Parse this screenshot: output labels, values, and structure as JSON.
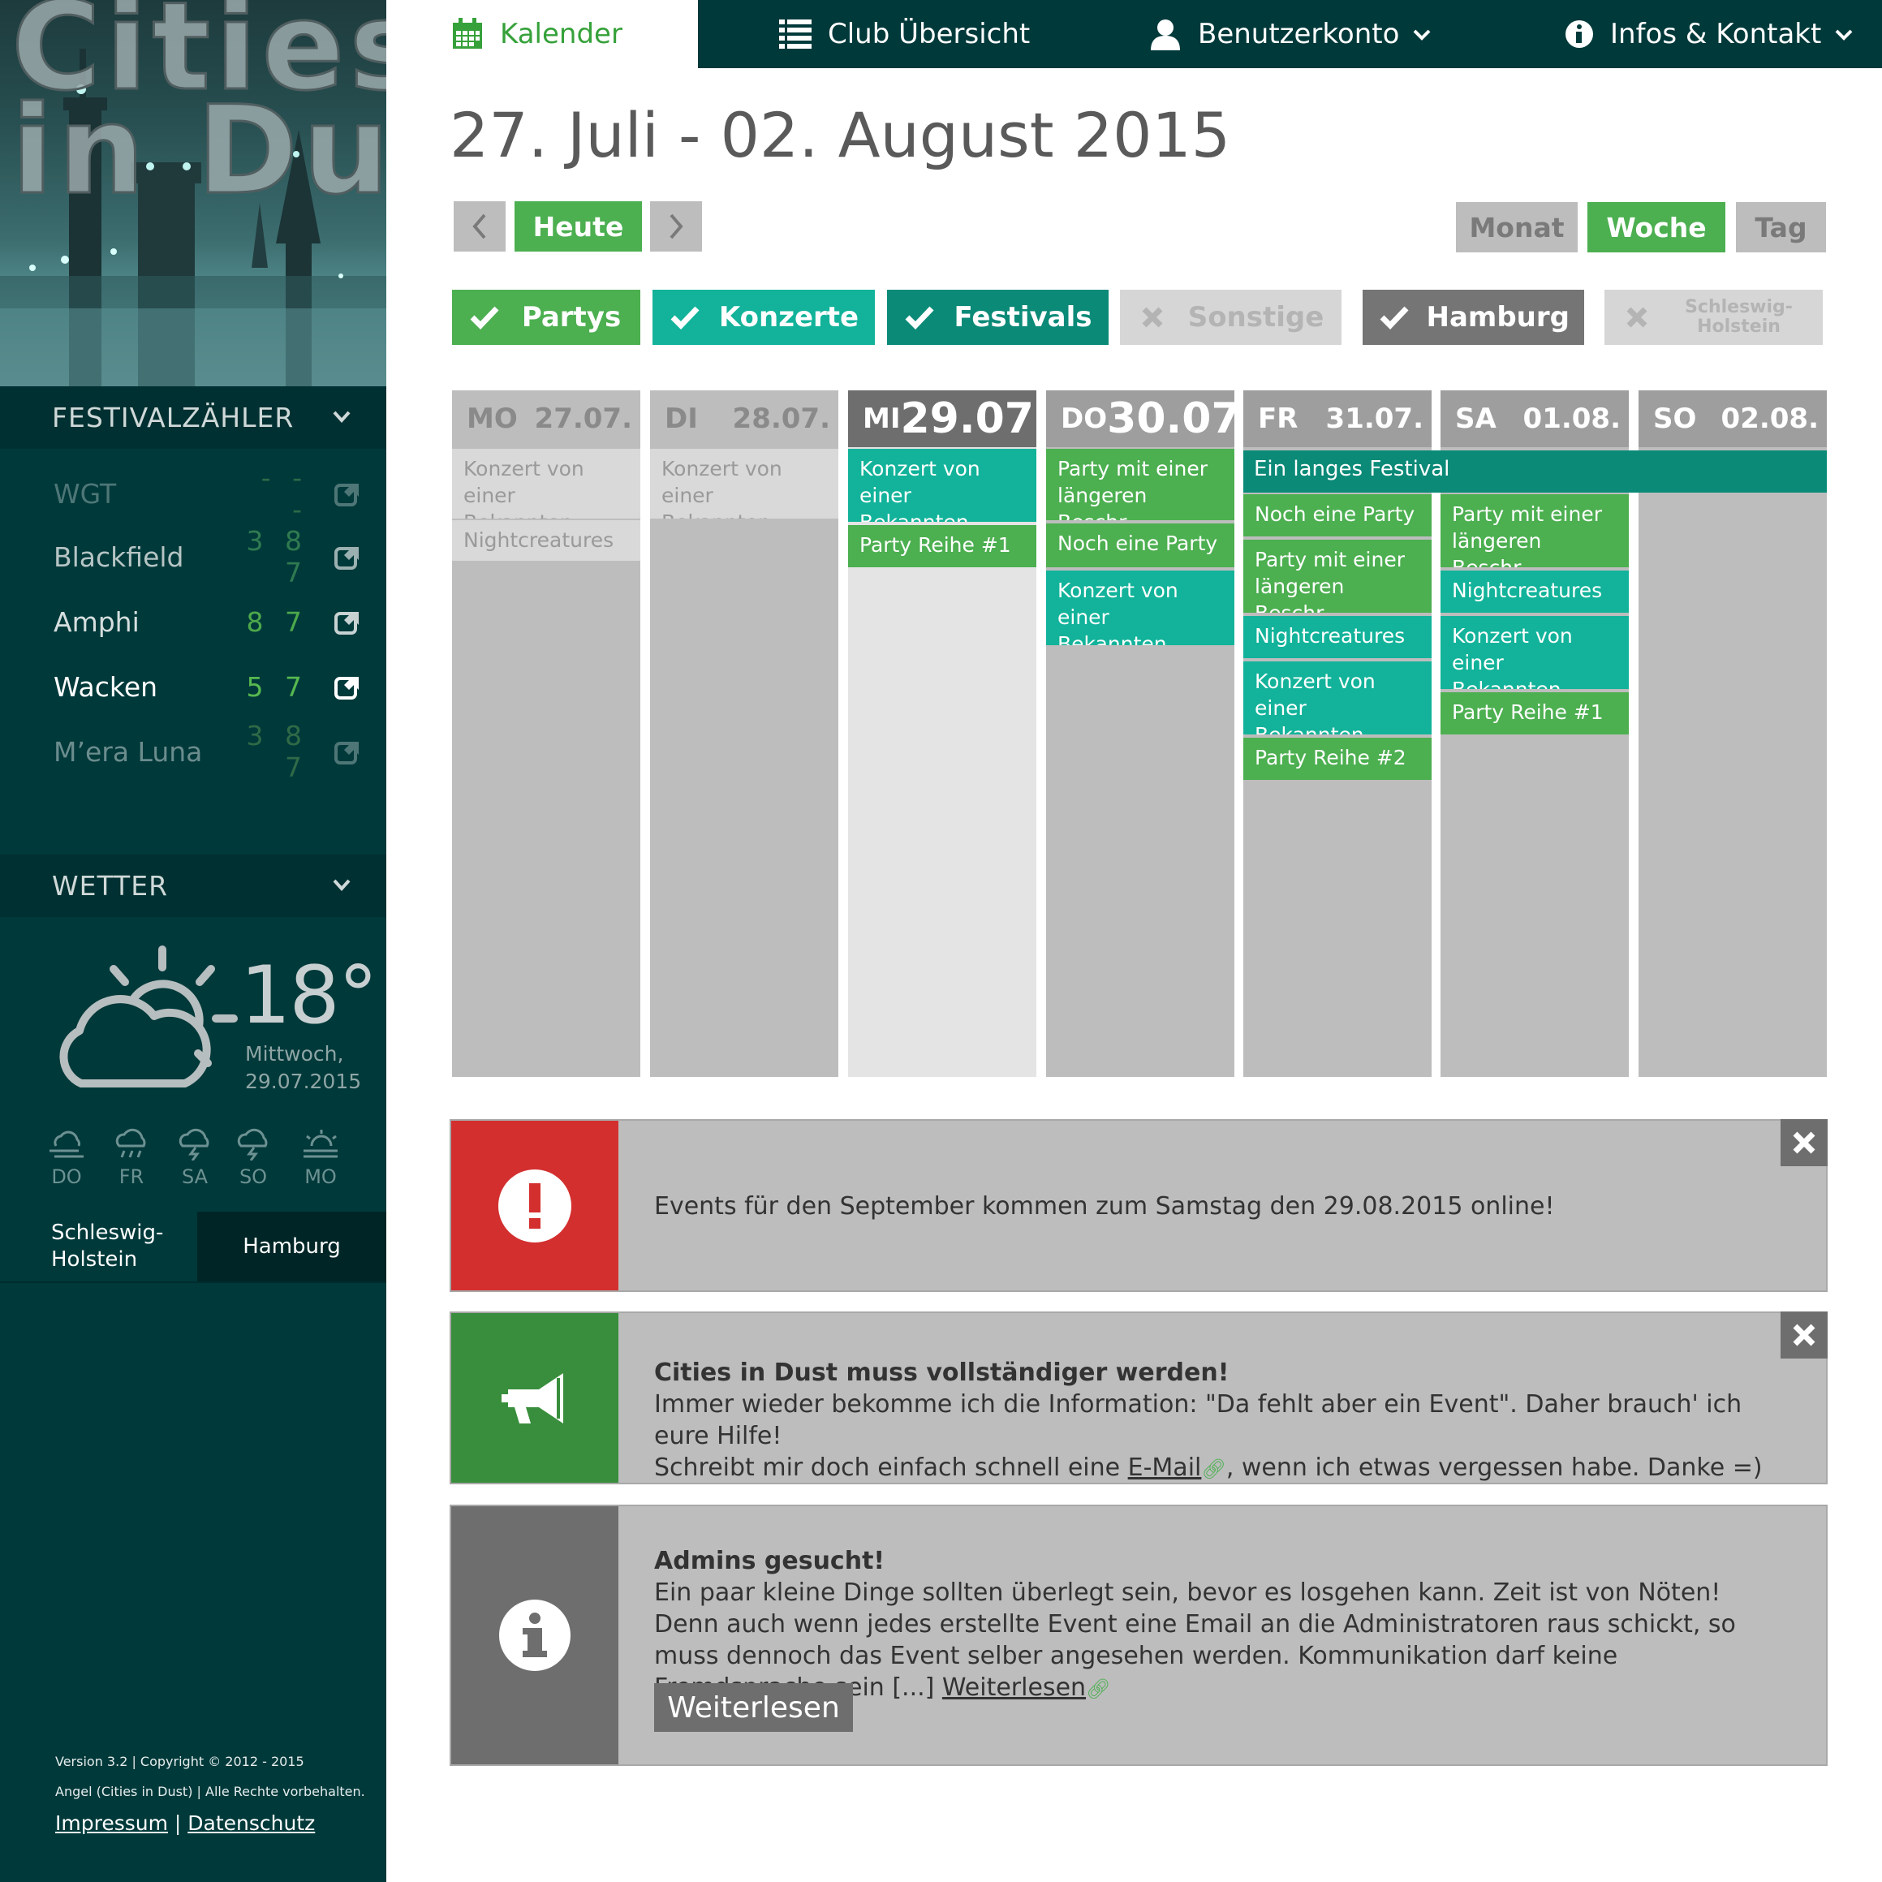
{
  "logo": {
    "line1": "Cities",
    "line2": "in Dust"
  },
  "sidebar": {
    "counter_title": "FESTIVALZÄHLER",
    "counters": [
      {
        "name": "WGT",
        "value": "- - -"
      },
      {
        "name": "Blackfield",
        "value": "3 8 7"
      },
      {
        "name": "Amphi",
        "value": "8 7"
      },
      {
        "name": "Wacken",
        "value": "5 7"
      },
      {
        "name": "M’era Luna",
        "value": "3 8 7"
      }
    ],
    "weather_title": "WETTER",
    "weather": {
      "temp": "18°",
      "day": "Mittwoch,",
      "date": "29.07.2015",
      "icon": "partly-cloudy-icon",
      "forecast": [
        {
          "day": "DO",
          "icon": "wind-cloud-icon"
        },
        {
          "day": "FR",
          "icon": "rain-cloud-icon"
        },
        {
          "day": "SA",
          "icon": "thunder-cloud-icon"
        },
        {
          "day": "SO",
          "icon": "thunder-cloud-icon"
        },
        {
          "day": "MO",
          "icon": "fog-sun-icon"
        }
      ]
    },
    "locations": {
      "first": "Schleswig-\nHolstein",
      "second": "Hamburg"
    },
    "footer": {
      "line1": "Version 3.2 | Copyright © 2012 - 2015",
      "line2": "Angel (Cities in Dust) | Alle Rechte vorbehalten.",
      "impressum": "Impressum",
      "sep": " | ",
      "datenschutz": "Datenschutz"
    }
  },
  "nav": {
    "calendar": "Kalender",
    "clubs": "Club Übersicht",
    "account": "Benutzerkonto",
    "info": "Infos & Kontakt"
  },
  "main": {
    "title": "27. Juli - 02. August 2015",
    "today": "Heute",
    "views": {
      "month": "Monat",
      "week": "Woche",
      "day": "Tag"
    },
    "filters": {
      "partys": "Partys",
      "konzerte": "Konzerte",
      "festivals": "Festivals",
      "sonstige": "Sonstige",
      "hamburg": "Hamburg",
      "sh": "Schleswig-\nHolstein"
    }
  },
  "calendar": {
    "days": [
      {
        "name": "MO",
        "date": "27.07.",
        "events": [
          "Konzert von einer Bekannten Band",
          "Nightcreatures"
        ]
      },
      {
        "name": "DI",
        "date": "28.07.",
        "events": [
          "Konzert von einer Bekannten Band"
        ]
      },
      {
        "name": "MI",
        "date": "29.07.",
        "events": [
          "Konzert von einer Bekannten Band",
          "Party Reihe #1"
        ]
      },
      {
        "name": "DO",
        "date": "30.07.",
        "events": [
          "Party mit einer längeren Beschr...",
          "Noch eine Party",
          "Konzert von einer Bekannten Band"
        ]
      },
      {
        "name": "FR",
        "date": "31.07.",
        "events": [
          "Noch eine Party",
          "Party mit einer längeren Beschr...",
          "Nightcreatures",
          "Konzert von einer Bekannten Band",
          "Party Reihe #2"
        ]
      },
      {
        "name": "SA",
        "date": "01.08.",
        "events": [
          "Party mit einer längeren Beschr...",
          "Nightcreatures",
          "Konzert von einer Bekannten Band",
          "Party Reihe #1"
        ]
      },
      {
        "name": "SO",
        "date": "02.08.",
        "events": []
      }
    ],
    "festival": "Ein langes Festival"
  },
  "notices": {
    "alert": {
      "text": "Events für den September kommen zum Samstag den 29.08.2015 online!"
    },
    "announce": {
      "title": "Cities in Dust muss vollständiger werden!",
      "line1": "Immer wieder bekomme ich die Information: \"Da fehlt aber ein Event\". Daher brauch' ich eure Hilfe!",
      "line2a": "Schreibt mir doch einfach schnell eine ",
      "link": "E-Mail",
      "line2b": ", wenn ich etwas vergessen habe. Danke =)"
    },
    "info": {
      "title": "Admins gesucht!",
      "text": "Ein paar kleine Dinge sollten überlegt sein, bevor es losgehen kann. Zeit ist von Nöten! Denn auch wenn jedes erstellte Event eine Email an die Administratoren raus schickt, so muss dennoch das Event selber angesehen werden. Kommunikation darf keine Fremdsprache sein [...] ",
      "link": "Weiterlesen",
      "button": "Weiterlesen"
    }
  },
  "colors": {
    "sidebar": "#00393a",
    "green": "#4caf50",
    "teal": "#12b39a",
    "festival": "#0b8a78",
    "gray": "#bdbdbd",
    "alert": "#d32f2f"
  }
}
